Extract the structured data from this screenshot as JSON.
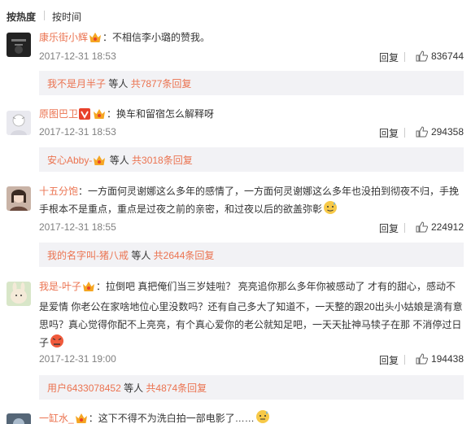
{
  "sort_tabs": {
    "hot": "按热度",
    "time": "按时间"
  },
  "colors": {
    "accent": "#eb7350",
    "reply_bg": "#f2f2f5",
    "meta": "#808080"
  },
  "comments": [
    {
      "username": "康乐街小辉",
      "sep": "：",
      "text": "不相信李小璐的赞我。",
      "timestamp": "2017-12-31 18:53",
      "reply_label": "回复",
      "likes": "836744",
      "reply_box": {
        "user": "我不是月半子",
        "mid": " 等人 ",
        "count": "共7877条回复"
      }
    },
    {
      "username": "原图巴卫",
      "sep": "：",
      "text": "换车和留宿怎么解释呀",
      "timestamp": "2017-12-31 18:53",
      "reply_label": "回复",
      "likes": "294358",
      "reply_box": {
        "user": "安心Abby-",
        "mid": " 等人 ",
        "count": "共3018条回复"
      }
    },
    {
      "username": "十五分饱",
      "sep": "：",
      "text": "一方面何灵谢娜这么多年的感情了，一方面何灵谢娜这么多年也没拍到彻夜不归，手挽手根本不是重点，重点是过夜之前的亲密，和过夜以后的欲盖弥彰",
      "timestamp": "2017-12-31 18:55",
      "reply_label": "回复",
      "likes": "224912",
      "reply_box": {
        "user": "我的名字叫-猪八戒",
        "mid": " 等人 ",
        "count": "共2644条回复"
      }
    },
    {
      "username": "我是-叶子",
      "sep": "：",
      "text": "拉倒吧 真把俺们当三岁娃啦？ 亮亮追你那么多年你被感动了 才有的甜心，感动不是爱情 你老公在家啥地位心里没数吗？还有自己多大了知道不，一天整的跟20出头小姑娘是滴有意思吗？真心觉得你配不上亮亮，有个真心爱你的老公就知足吧，一天天扯神马犊子在那 不消停过日子",
      "timestamp": "2017-12-31 19:00",
      "reply_label": "回复",
      "likes": "194438",
      "reply_box": {
        "user": "用户6433078452",
        "mid": " 等人 ",
        "count": "共4874条回复"
      }
    },
    {
      "username": "一缸水_",
      "sep": "：",
      "text": "这下不得不为洗白拍一部电影了……"
    }
  ]
}
